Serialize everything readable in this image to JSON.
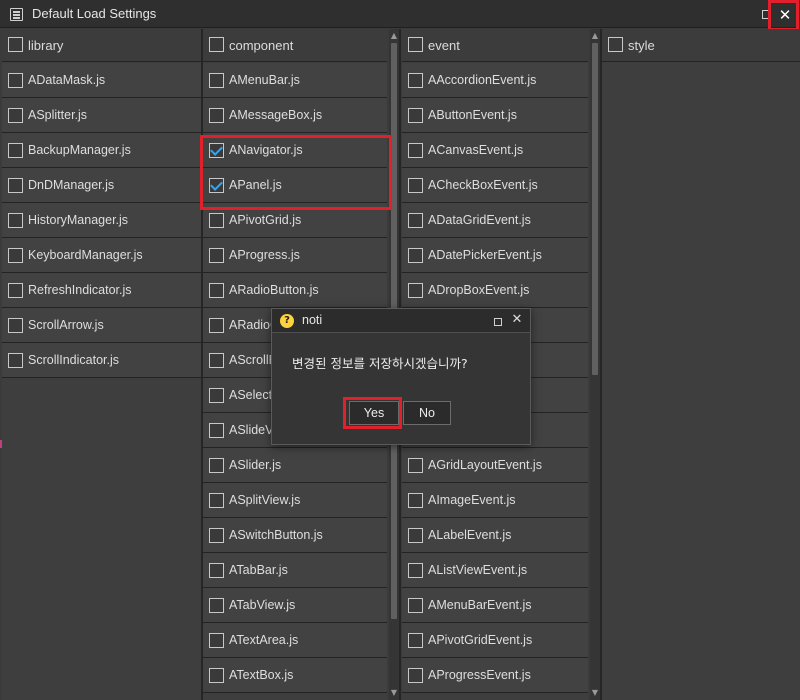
{
  "window": {
    "title": "Default Load Settings",
    "icon": "window-list-icon",
    "maximize_icon": "maximize-icon",
    "close_glyph": "✕"
  },
  "columns": {
    "library": {
      "header": "library",
      "items": [
        {
          "label": "ADataMask.js",
          "checked": false
        },
        {
          "label": "ASplitter.js",
          "checked": false
        },
        {
          "label": "BackupManager.js",
          "checked": false
        },
        {
          "label": "DnDManager.js",
          "checked": false
        },
        {
          "label": "HistoryManager.js",
          "checked": false
        },
        {
          "label": "KeyboardManager.js",
          "checked": false
        },
        {
          "label": "RefreshIndicator.js",
          "checked": false
        },
        {
          "label": "ScrollArrow.js",
          "checked": false
        },
        {
          "label": "ScrollIndicator.js",
          "checked": false
        }
      ]
    },
    "component": {
      "header": "component",
      "items": [
        {
          "label": "AMenuBar.js",
          "checked": false
        },
        {
          "label": "AMessageBox.js",
          "checked": false
        },
        {
          "label": "ANavigator.js",
          "checked": true
        },
        {
          "label": "APanel.js",
          "checked": true
        },
        {
          "label": "APivotGrid.js",
          "checked": false
        },
        {
          "label": "AProgress.js",
          "checked": false
        },
        {
          "label": "ARadioButton.js",
          "checked": false
        },
        {
          "label": "ARadioG",
          "checked": false
        },
        {
          "label": "AScrollE",
          "checked": false
        },
        {
          "label": "ASelectI",
          "checked": false
        },
        {
          "label": "ASlideVi",
          "checked": false
        },
        {
          "label": "ASlider.js",
          "checked": false
        },
        {
          "label": "ASplitView.js",
          "checked": false
        },
        {
          "label": "ASwitchButton.js",
          "checked": false
        },
        {
          "label": "ATabBar.js",
          "checked": false
        },
        {
          "label": "ATabView.js",
          "checked": false
        },
        {
          "label": "ATextArea.js",
          "checked": false
        },
        {
          "label": "ATextBox.js",
          "checked": false
        }
      ]
    },
    "event": {
      "header": "event",
      "items": [
        {
          "label": "AAccordionEvent.js",
          "checked": false
        },
        {
          "label": "AButtonEvent.js",
          "checked": false
        },
        {
          "label": "ACanvasEvent.js",
          "checked": false
        },
        {
          "label": "ACheckBoxEvent.js",
          "checked": false
        },
        {
          "label": "ADataGridEvent.js",
          "checked": false
        },
        {
          "label": "ADatePickerEvent.js",
          "checked": false
        },
        {
          "label": "ADropBoxEvent.js",
          "checked": false
        },
        {
          "label": "s",
          "checked": false
        },
        {
          "label": "",
          "checked": false
        },
        {
          "label": "",
          "checked": false
        },
        {
          "label": "",
          "checked": false
        },
        {
          "label": "AGridLayoutEvent.js",
          "checked": false
        },
        {
          "label": "AImageEvent.js",
          "checked": false
        },
        {
          "label": "ALabelEvent.js",
          "checked": false
        },
        {
          "label": "AListViewEvent.js",
          "checked": false
        },
        {
          "label": "AMenuBarEvent.js",
          "checked": false
        },
        {
          "label": "APivotGridEvent.js",
          "checked": false
        },
        {
          "label": "AProgressEvent.js",
          "checked": false
        }
      ]
    },
    "style": {
      "header": "style",
      "items": []
    }
  },
  "dialog": {
    "title": "noti",
    "title_icon": "question-icon",
    "message": "변경된 정보를 저장하시겠습니까?",
    "yes_label": "Yes",
    "no_label": "No"
  },
  "colors": {
    "highlight": "#e0202a",
    "check": "#33a6f0",
    "background": "#3e3e3e"
  }
}
